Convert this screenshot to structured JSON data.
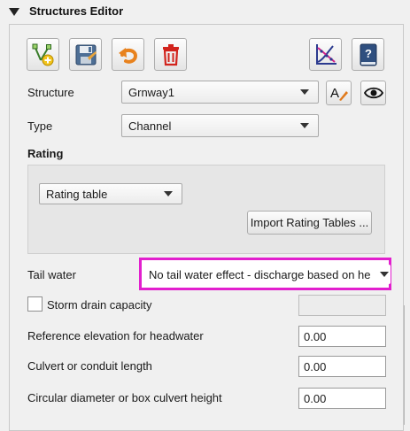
{
  "header": {
    "title": "Structures Editor"
  },
  "toolbar": {
    "buttons": [
      {
        "icon": "add-structure-icon"
      },
      {
        "icon": "save-disk-icon"
      },
      {
        "icon": "undo-arrow-icon"
      },
      {
        "icon": "trash-icon"
      },
      {
        "icon": "rating-curve-plot-icon"
      },
      {
        "icon": "help-book-icon"
      }
    ]
  },
  "structure": {
    "label": "Structure",
    "value": "Grnway1",
    "rename_icon": "rename-text-icon",
    "visibility_icon": "eye-icon"
  },
  "type": {
    "label": "Type",
    "value": "Channel"
  },
  "rating": {
    "title": "Rating",
    "mode": "Rating table",
    "import_button": "Import Rating Tables ..."
  },
  "tail_water": {
    "label": "Tail water",
    "value": "No tail water effect - discharge based on he"
  },
  "storm_drain": {
    "label": "Storm drain capacity",
    "checked": false,
    "value": ""
  },
  "fields": [
    {
      "label": "Reference elevation for headwater",
      "value": "0.00"
    },
    {
      "label": "Culvert or conduit length",
      "value": "0.00"
    },
    {
      "label": "Circular diameter or box culvert height",
      "value": "0.00"
    }
  ],
  "colors": {
    "highlight": "#e21fce",
    "undo_orange": "#e8821e",
    "trash_red": "#d2241d",
    "help_blue": "#2f4f7f"
  }
}
